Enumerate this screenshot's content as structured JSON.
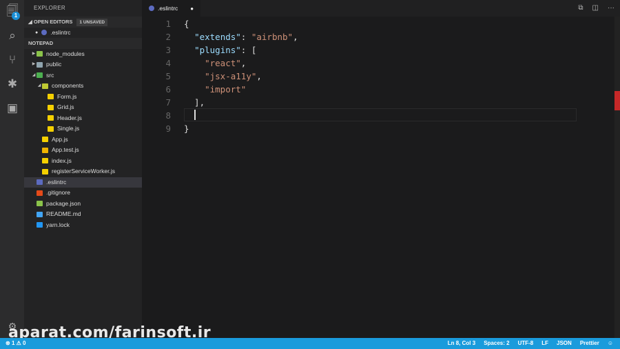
{
  "activity": {
    "explorer_badge": "1"
  },
  "sidebar": {
    "title": "EXPLORER",
    "open_editors": "OPEN EDITORS",
    "unsaved": "1 UNSAVED",
    "open_file": ".eslintrc",
    "project": "NOTEPAD",
    "tree": [
      {
        "name": "node_modules",
        "depth": 0,
        "type": "folder",
        "open": false,
        "color": "#8bc34a"
      },
      {
        "name": "public",
        "depth": 0,
        "type": "folder",
        "open": false,
        "color": "#90a4ae"
      },
      {
        "name": "src",
        "depth": 0,
        "type": "folder",
        "open": true,
        "color": "#4caf50"
      },
      {
        "name": "components",
        "depth": 1,
        "type": "folder",
        "open": true,
        "color": "#c0ca33"
      },
      {
        "name": "Form.js",
        "depth": 2,
        "type": "file",
        "color": "#f5d000"
      },
      {
        "name": "Grid.js",
        "depth": 2,
        "type": "file",
        "color": "#f5d000"
      },
      {
        "name": "Header.js",
        "depth": 2,
        "type": "file",
        "color": "#f5d000"
      },
      {
        "name": "Single.js",
        "depth": 2,
        "type": "file",
        "color": "#f5d000"
      },
      {
        "name": "App.js",
        "depth": 1,
        "type": "file",
        "color": "#f5d000"
      },
      {
        "name": "App.test.js",
        "depth": 1,
        "type": "file",
        "color": "#f0b400"
      },
      {
        "name": "index.js",
        "depth": 1,
        "type": "file",
        "color": "#f5d000"
      },
      {
        "name": "registerServiceWorker.js",
        "depth": 1,
        "type": "file",
        "color": "#f5d000"
      },
      {
        "name": ".eslintrc",
        "depth": 0,
        "type": "file",
        "color": "#5c6bc0",
        "selected": true
      },
      {
        "name": ".gitignore",
        "depth": 0,
        "type": "file",
        "color": "#e64a19"
      },
      {
        "name": "package.json",
        "depth": 0,
        "type": "file",
        "color": "#8bc34a"
      },
      {
        "name": "README.md",
        "depth": 0,
        "type": "file",
        "color": "#42a5f5"
      },
      {
        "name": "yarn.lock",
        "depth": 0,
        "type": "file",
        "color": "#2196f3"
      }
    ]
  },
  "editor": {
    "tab": ".eslintrc",
    "lines": [
      [
        [
          "p",
          "{"
        ]
      ],
      [
        [
          "p",
          "  "
        ],
        [
          "k",
          "\"extends\""
        ],
        [
          "p",
          ": "
        ],
        [
          "s",
          "\"airbnb\""
        ],
        [
          "p",
          ","
        ]
      ],
      [
        [
          "p",
          "  "
        ],
        [
          "k",
          "\"plugins\""
        ],
        [
          "p",
          ": ["
        ]
      ],
      [
        [
          "p",
          "    "
        ],
        [
          "s",
          "\"react\""
        ],
        [
          "p",
          ","
        ]
      ],
      [
        [
          "p",
          "    "
        ],
        [
          "s",
          "\"jsx-a11y\""
        ],
        [
          "p",
          ","
        ]
      ],
      [
        [
          "p",
          "    "
        ],
        [
          "s",
          "\"import\""
        ]
      ],
      [
        [
          "p",
          "  ],"
        ]
      ],
      [
        [
          "p",
          "  "
        ]
      ],
      [
        [
          "p",
          "}"
        ]
      ]
    ]
  },
  "status": {
    "errors": "1",
    "warnings": "0",
    "position": "Ln 8, Col 3",
    "spaces": "Spaces: 2",
    "encoding": "UTF-8",
    "eol": "LF",
    "language": "JSON",
    "formatter": "Prettier"
  },
  "watermark": "aparat.com/farinsoft.ir"
}
